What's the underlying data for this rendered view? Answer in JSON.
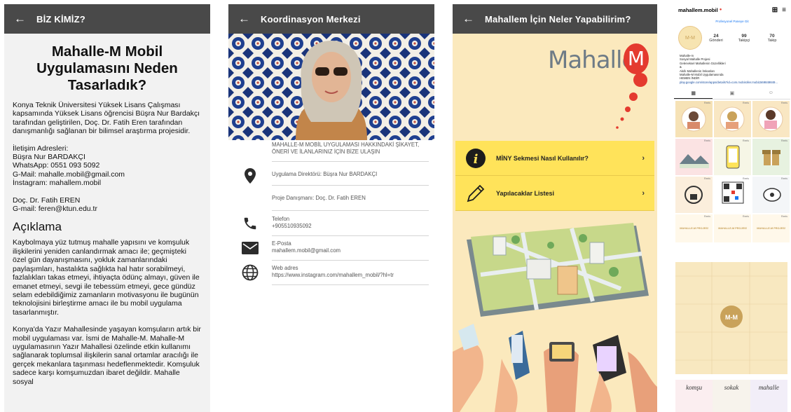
{
  "screen1": {
    "appbar_title": "BİZ KİMİZ?",
    "heading": "Mahalle-M Mobil Uygulamasını Neden Tasarladık?",
    "intro": "Konya Teknik Üniversitesi Yüksek Lisans Çalışması kapsamında Yüksek Lisans öğrencisi Büşra Nur Bardakçı tarafından geliştirilen, Doç. Dr. Fatih Eren tarafından danışmanlığı sağlanan bir bilimsel araştırma projesidir.",
    "contact_title": "İletişim Adresleri:",
    "contact_name": "Büşra Nur BARDAKÇI",
    "contact_whatsapp": "WhatsApp: 0551 093 5092",
    "contact_gmail": "G-Mail: mahalle.mobil@gmail.com",
    "contact_instagram": "İnstagram: mahallem.mobil",
    "advisor_name": "Doç. Dr. Fatih EREN",
    "advisor_mail": "G-mail: feren@ktun.edu.tr",
    "section_title": "Açıklama",
    "para1": "Kaybolmaya yüz tutmuş mahalle yapısını ve komşuluk ilişkilerini yeniden canlandırmak amacı ile; geçmişteki özel gün dayanışmasını, yokluk zamanlarındaki paylaşımları, hastalıkta sağlıkta hal hatır sorabilmeyi, fazlalıkları takas etmeyi, ihtiyaçta ödünç almayı, güven ile emanet etmeyi, sevgi ile tebessüm etmeyi, gece gündüz selam edebildiğimiz zamanların motivasyonu ile bugünün teknolojisini birleştirme amacı ile bu mobil uygulama tasarlanmıştır.",
    "para2": "Konya'da Yazır Mahallesinde yaşayan komşuların artık bir mobil uygulaması var. İsmi de Mahalle-M. Mahalle-M uygulamasının Yazır Mahallesi özelinde etkin kullanımı sağlanarak toplumsal ilişkilerin sanal ortamlar aracılığı ile gerçek mekanlara taşınması hedeflenmektedir. Komşuluk sadece karşı komşumuzdan ibaret değildir. Mahalle sosyal"
  },
  "screen2": {
    "appbar_title": "Koordinasyon Merkezi",
    "notice": "MAHALLE-M MOBİL UYGULAMASI HAKKINDAKİ ŞİKAYET, ÖNERİ VE İLANLARINIZ İÇİN BİZE ULAŞIN",
    "director": "Uygulama Direktörü: Büşra Nur BARDAKÇI",
    "advisor": "Proje Danışmanı: Doç. Dr. Fatih EREN",
    "phone_label": "Telefon",
    "phone_value": "+905510935092",
    "email_label": "E-Posta",
    "email_value": "mahallem.mobil@gmail.com",
    "web_label": "Web adres",
    "web_value": "https://www.instagram.com/mahallem_mobil/?hl=tr"
  },
  "screen3": {
    "appbar_title": "Mahallem İçin Neler Yapabilirim?",
    "logo_text": "Mahalle-",
    "logo_badge": "M",
    "menu": [
      {
        "label": "MİNY Sekmesi Nasıl Kullanılır?",
        "chevron": "›"
      },
      {
        "label": "Yapılacaklar Listesi",
        "chevron": "›"
      }
    ]
  },
  "screen4": {
    "username": "mahallem.mobil",
    "pro_panel": "Profesyonel Paneye Git",
    "avatar_text": "M-M",
    "stats": [
      {
        "value": "24",
        "label": "Gönderi"
      },
      {
        "value": "99",
        "label": "Takipçi"
      },
      {
        "value": "70",
        "label": "Takip"
      }
    ],
    "bio_lines": [
      "Mahalle-m",
      "Sosyal Mahalle Projesi",
      "Geleneksel Mahallenin Güzellikleri",
      "&",
      "Akıllı Mahallenin İmkanları",
      "Mahalle-M Mobil Uygulamasında",
      "HEMEN İNDİR"
    ],
    "bio_link": "play.google.com/store/apps/details?id=com.mobiroller.mobi1569849849...",
    "reels_tag": "Reels",
    "card_title": "MAHALLE-M PROJESİ",
    "banner_words": [
      "komşu",
      "sokak",
      "mahalle"
    ]
  },
  "colors": {
    "appbar": "#494949",
    "screen3_bg": "#fbe9bd",
    "menu_bg": "#ffe35a",
    "logo_red": "#e43a2f"
  }
}
